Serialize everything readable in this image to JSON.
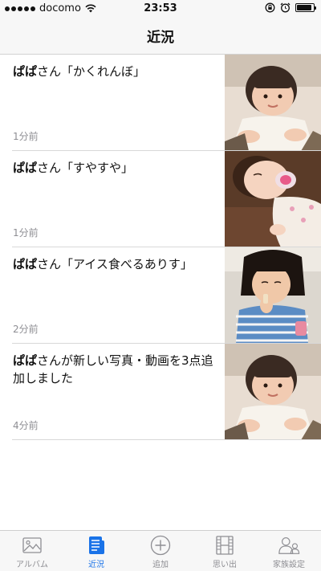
{
  "status_bar": {
    "carrier": "docomo",
    "time": "23:53",
    "battery_level": 0.9
  },
  "nav": {
    "title": "近況"
  },
  "feed": [
    {
      "author": "ぱぱ",
      "text": "さん「かくれんぼ」",
      "time": "1分前",
      "photo": "toddler-crawling-photo"
    },
    {
      "author": "ぱぱ",
      "text": "さん「すやすや」",
      "time": "1分前",
      "photo": "baby-with-pacifier-photo"
    },
    {
      "author": "ぱぱ",
      "text": "さん「アイス食べるありす」",
      "time": "2分前",
      "photo": "girl-eating-ice-cream-photo"
    },
    {
      "author": "ぱぱ",
      "text": "さんが新しい写真・動画を3点追加しました",
      "time": "4分前",
      "photo": "toddler-crawling-photo"
    }
  ],
  "tabbar": {
    "active_color": "#1a73e8",
    "items": [
      {
        "label": "アルバム",
        "icon": "photo-album-icon"
      },
      {
        "label": "近況",
        "icon": "newsfeed-icon",
        "active": true
      },
      {
        "label": "追加",
        "icon": "plus-circle-icon"
      },
      {
        "label": "思い出",
        "icon": "film-strip-icon"
      },
      {
        "label": "家族設定",
        "icon": "family-people-icon"
      }
    ]
  }
}
